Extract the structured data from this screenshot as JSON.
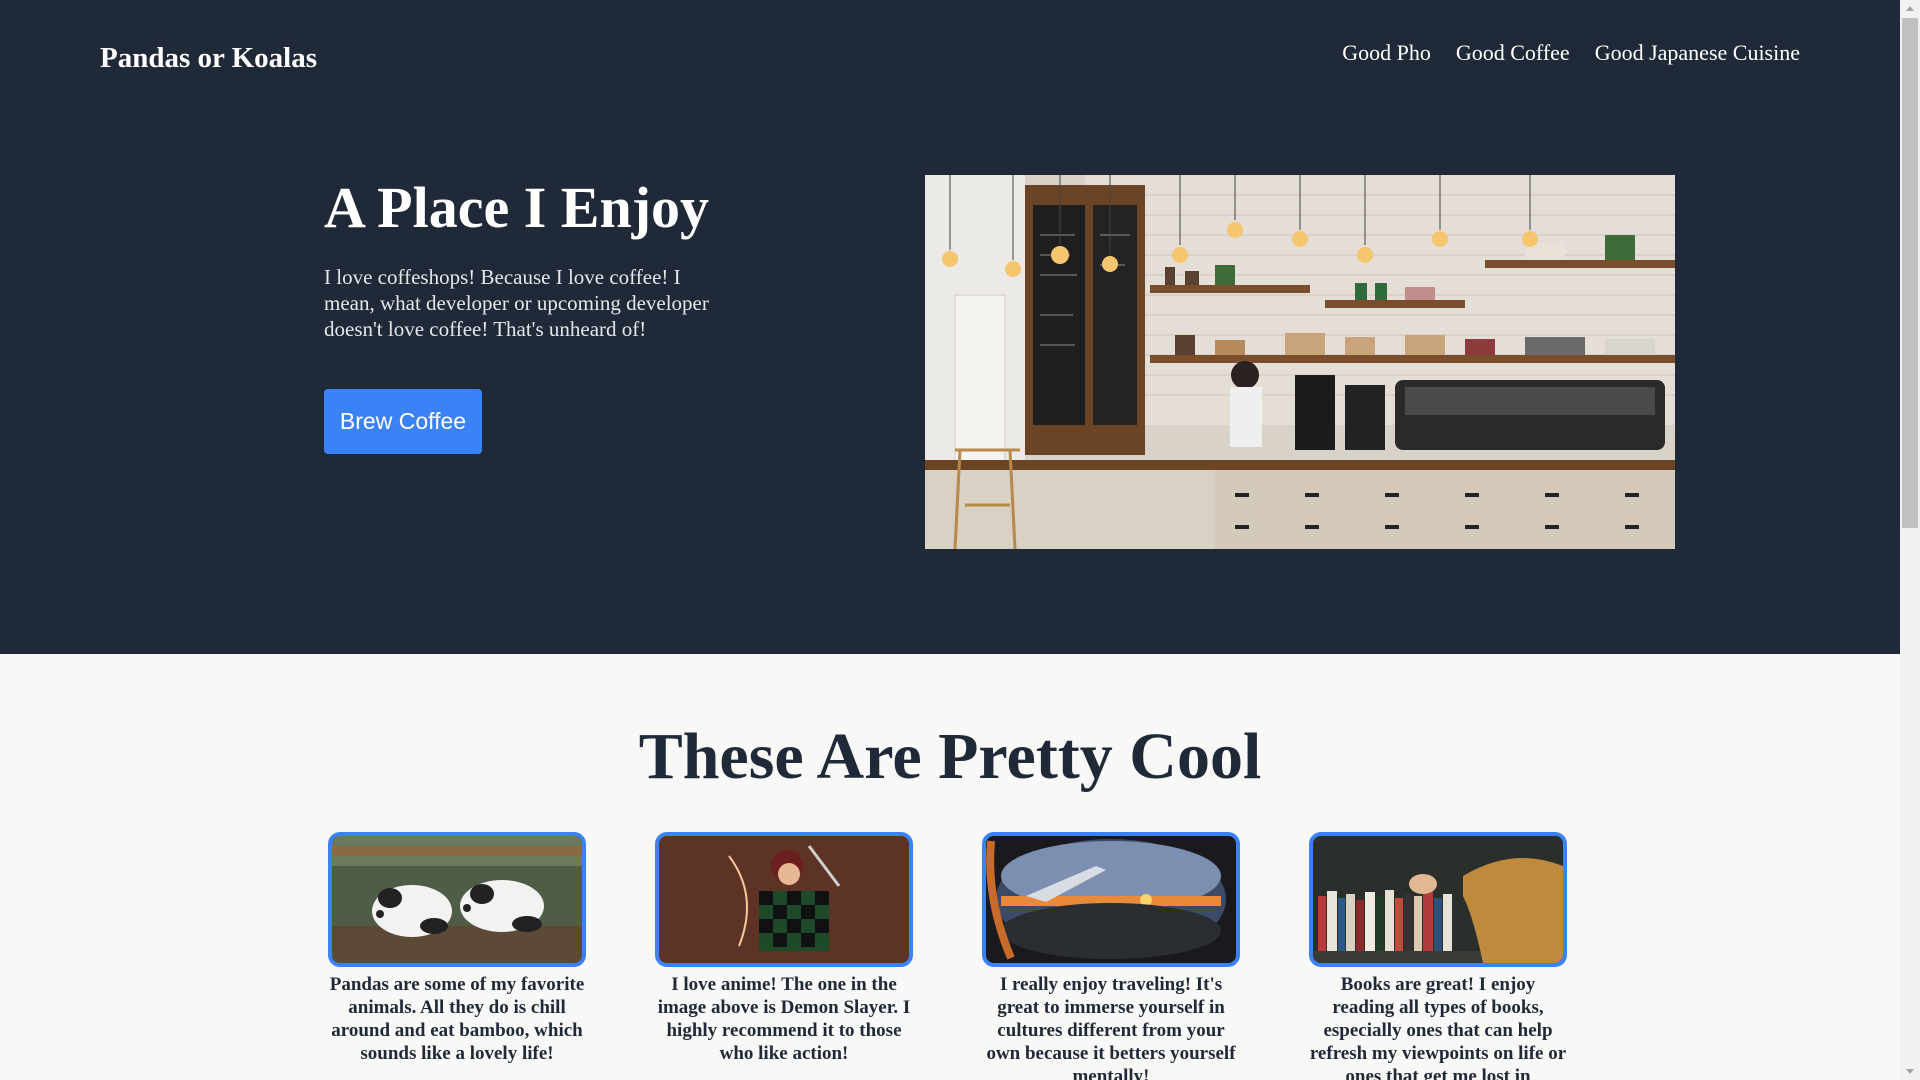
{
  "header": {
    "brand": "Pandas or Koalas",
    "nav": [
      {
        "label": "Good Pho"
      },
      {
        "label": "Good Coffee"
      },
      {
        "label": "Good Japanese Cuisine"
      }
    ]
  },
  "hero": {
    "title": "A Place I Enjoy",
    "text": "I love coffeshops! Because I love coffee! I mean, what developer or upcoming developer doesn't love coffee! That's unheard of!",
    "button_label": "Brew Coffee",
    "image_name": "coffee-shop-photo"
  },
  "cool_section": {
    "title": "These Are Pretty Cool",
    "cards": [
      {
        "image_name": "pandas-photo",
        "text": "Pandas are some of my favorite animals. All they do is chill around and eat bamboo, which sounds like a lovely life!"
      },
      {
        "image_name": "anime-photo",
        "text": "I love anime! The one in the image above is Demon Slayer. I highly recommend it to those who like action!"
      },
      {
        "image_name": "airplane-window-photo",
        "text": "I really enjoy traveling! It's great to immerse yourself in cultures different from your own because it betters yourself mentally!"
      },
      {
        "image_name": "bookshelf-photo",
        "text": "Books are great! I enjoy reading all types of books, especially ones that can help refresh my viewpoints on life or ones that get me lost in"
      }
    ]
  },
  "colors": {
    "dark_background": "#1f2937",
    "accent": "#3b82f6",
    "light_background": "#f8f8f6"
  }
}
